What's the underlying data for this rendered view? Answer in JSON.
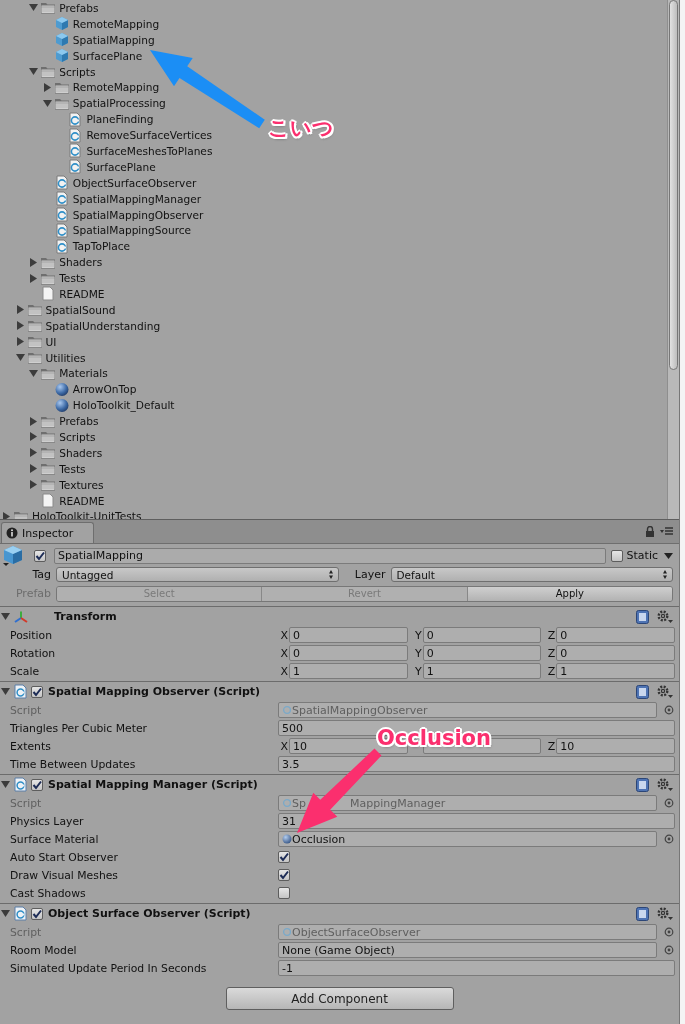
{
  "project_tree": {
    "items": [
      {
        "children": [
          {
            "children": [
              {
                "label": "Prefabs",
                "kind": "folder",
                "expanded": true,
                "children": [
                  {
                    "label": "RemoteMapping",
                    "kind": "prefab"
                  },
                  {
                    "label": "SpatialMapping",
                    "kind": "prefab"
                  },
                  {
                    "label": "SurfacePlane",
                    "kind": "prefab"
                  }
                ]
              },
              {
                "label": "Scripts",
                "kind": "folder",
                "expanded": true,
                "children": [
                  {
                    "label": "RemoteMapping",
                    "kind": "folder",
                    "expanded": false
                  },
                  {
                    "label": "SpatialProcessing",
                    "kind": "folder",
                    "expanded": true,
                    "children": [
                      {
                        "label": "PlaneFinding",
                        "kind": "script"
                      },
                      {
                        "label": "RemoveSurfaceVertices",
                        "kind": "script"
                      },
                      {
                        "label": "SurfaceMeshesToPlanes",
                        "kind": "script"
                      },
                      {
                        "label": "SurfacePlane",
                        "kind": "script"
                      }
                    ]
                  },
                  {
                    "label": "ObjectSurfaceObserver",
                    "kind": "script"
                  },
                  {
                    "label": "SpatialMappingManager",
                    "kind": "script"
                  },
                  {
                    "label": "SpatialMappingObserver",
                    "kind": "script"
                  },
                  {
                    "label": "SpatialMappingSource",
                    "kind": "script"
                  },
                  {
                    "label": "TapToPlace",
                    "kind": "script"
                  }
                ]
              },
              {
                "label": "Shaders",
                "kind": "folder",
                "expanded": false
              },
              {
                "label": "Tests",
                "kind": "folder",
                "expanded": false
              },
              {
                "label": "README",
                "kind": "file"
              }
            ]
          },
          {
            "label": "SpatialSound",
            "kind": "folder",
            "expanded": false
          },
          {
            "label": "SpatialUnderstanding",
            "kind": "folder",
            "expanded": false
          },
          {
            "label": "UI",
            "kind": "folder",
            "expanded": false
          },
          {
            "label": "Utilities",
            "kind": "folder",
            "expanded": true,
            "children": [
              {
                "label": "Materials",
                "kind": "folder",
                "expanded": true,
                "children": [
                  {
                    "label": "ArrowOnTop",
                    "kind": "material"
                  },
                  {
                    "label": "HoloToolkit_Default",
                    "kind": "material"
                  }
                ]
              },
              {
                "label": "Prefabs",
                "kind": "folder",
                "expanded": false
              },
              {
                "label": "Scripts",
                "kind": "folder",
                "expanded": false
              },
              {
                "label": "Shaders",
                "kind": "folder",
                "expanded": false
              },
              {
                "label": "Tests",
                "kind": "folder",
                "expanded": false
              },
              {
                "label": "Textures",
                "kind": "folder",
                "expanded": false
              },
              {
                "label": "README",
                "kind": "file"
              }
            ]
          }
        ]
      },
      {
        "label": "HoloToolkit-UnitTests",
        "kind": "folder",
        "expanded": false
      }
    ]
  },
  "inspector": {
    "tab": "Inspector",
    "object": {
      "active": true,
      "name": "SpatialMapping",
      "static": false,
      "static_label": "Static"
    },
    "tag": {
      "label": "Tag",
      "value": "Untagged"
    },
    "layer": {
      "label": "Layer",
      "value": "Default"
    },
    "prefab": {
      "label": "Prefab",
      "buttons": [
        {
          "label": "Select",
          "disabled": true
        },
        {
          "label": "Revert",
          "disabled": true
        },
        {
          "label": "Apply",
          "disabled": false
        }
      ]
    },
    "components": [
      {
        "kind": "transform",
        "title": "Transform",
        "expanded": true,
        "rows": [
          {
            "kind": "vector3",
            "label": "Position",
            "fields": [
              {
                "axis": "X",
                "value": "0"
              },
              {
                "axis": "Y",
                "value": "0"
              },
              {
                "axis": "Z",
                "value": "0"
              }
            ]
          },
          {
            "kind": "vector3",
            "label": "Rotation",
            "fields": [
              {
                "axis": "X",
                "value": "0"
              },
              {
                "axis": "Y",
                "value": "0"
              },
              {
                "axis": "Z",
                "value": "0"
              }
            ]
          },
          {
            "kind": "vector3",
            "label": "Scale",
            "fields": [
              {
                "axis": "X",
                "value": "1"
              },
              {
                "axis": "Y",
                "value": "1"
              },
              {
                "axis": "Z",
                "value": "1"
              }
            ]
          }
        ]
      },
      {
        "kind": "script",
        "title": "Spatial Mapping Observer (Script)",
        "enabled": true,
        "expanded": true,
        "rows": [
          {
            "kind": "script",
            "label": "Script",
            "value": "SpatialMappingObserver"
          },
          {
            "kind": "text",
            "label": "Triangles Per Cubic Meter",
            "value": "500"
          },
          {
            "kind": "vector3",
            "label": "Extents",
            "fields": [
              {
                "axis": "X",
                "value": "10"
              },
              {
                "covered": true
              },
              {
                "axis": "Z",
                "value": "10"
              }
            ]
          },
          {
            "kind": "text",
            "label": "Time Between Updates",
            "value": "3.5"
          }
        ]
      },
      {
        "kind": "script",
        "title": "Spatial Mapping Manager (Script)",
        "enabled": true,
        "expanded": true,
        "rows": [
          {
            "kind": "script",
            "label": "Script",
            "value_parts": [
              "Sp",
              "MappingManager"
            ]
          },
          {
            "kind": "text",
            "label": "Physics Layer",
            "value": "31"
          },
          {
            "kind": "material",
            "label": "Surface Material",
            "value": "Occlusion"
          },
          {
            "kind": "checkbox",
            "label": "Auto Start Observer",
            "checked": true
          },
          {
            "kind": "checkbox",
            "label": "Draw Visual Meshes",
            "checked": true
          },
          {
            "kind": "checkbox",
            "label": "Cast Shadows",
            "checked": false
          }
        ]
      },
      {
        "kind": "script",
        "title": "Object Surface Observer (Script)",
        "enabled": true,
        "expanded": true,
        "rows": [
          {
            "kind": "script",
            "label": "Script",
            "value": "ObjectSurfaceObserver"
          },
          {
            "kind": "object",
            "label": "Room Model",
            "value": "None (Game Object)"
          },
          {
            "kind": "text",
            "label": "Simulated Update Period In Seconds",
            "value": "-1"
          }
        ]
      }
    ],
    "add_component": "Add Component"
  },
  "annotations": [
    {
      "text": "こいつ",
      "color": "#1b8ef5"
    },
    {
      "text": "Occlusion",
      "color": "#fb2f6e"
    }
  ]
}
